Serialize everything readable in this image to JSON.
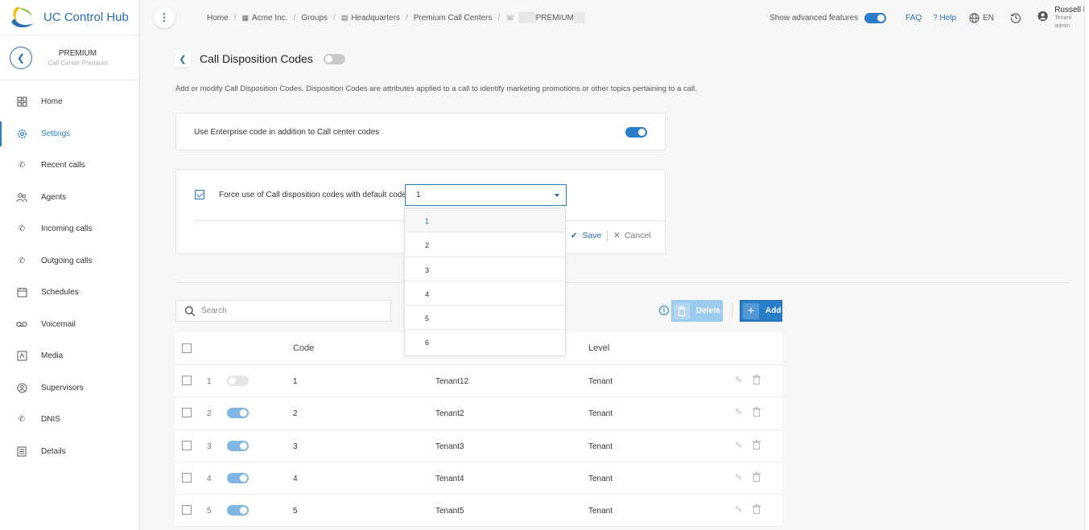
{
  "app": {
    "title": "UC Control Hub"
  },
  "context": {
    "title": "PREMIUM",
    "subtitle": "Call Center Premium"
  },
  "sidebar": {
    "items": [
      {
        "label": "Home",
        "icon": "grid-icon",
        "active": false
      },
      {
        "label": "Settings",
        "icon": "gear-icon",
        "active": true
      },
      {
        "label": "Recent calls",
        "icon": "phone-recent-icon",
        "active": false
      },
      {
        "label": "Agents",
        "icon": "agents-icon",
        "active": false
      },
      {
        "label": "Incoming calls",
        "icon": "phone-incoming-icon",
        "active": false
      },
      {
        "label": "Outgoing calls",
        "icon": "phone-outgoing-icon",
        "active": false
      },
      {
        "label": "Schedules",
        "icon": "calendar-icon",
        "active": false
      },
      {
        "label": "Voicemail",
        "icon": "voicemail-icon",
        "active": false
      },
      {
        "label": "Media",
        "icon": "media-icon",
        "active": false
      },
      {
        "label": "Supervisors",
        "icon": "supervisors-icon",
        "active": false
      },
      {
        "label": "DNIS",
        "icon": "phone-dnis-icon",
        "active": false
      },
      {
        "label": "Details",
        "icon": "details-icon",
        "active": false
      }
    ]
  },
  "breadcrumb": {
    "items": [
      "Home",
      "Acme Inc.",
      "Groups",
      "Headquarters",
      "Premium Call Centers",
      "PREMIUM"
    ]
  },
  "topbar": {
    "advanced_label": "Show advanced features",
    "advanced_on": true,
    "faq": "FAQ",
    "help": "Help",
    "language": "EN",
    "user_name": "Russell N",
    "user_role_1": "Tenant",
    "user_role_2": "admin"
  },
  "page": {
    "title": "Call Disposition Codes",
    "enabled": false,
    "description": "Add or modify Call Disposition Codes. Disposition Codes are attributes applied to a call to identify marketing promotions or other topics pertaining to a call."
  },
  "enterprise": {
    "label": "Use Enterprise code in addition to Call center codes",
    "on": true
  },
  "force": {
    "label": "Force use of Call disposition codes with default code:",
    "checked": true,
    "value": "1",
    "options": [
      "1",
      "2",
      "3",
      "4",
      "5",
      "6"
    ],
    "save": "Save",
    "cancel": "Cancel"
  },
  "toolbar": {
    "search_placeholder": "Search",
    "delete": "Delete",
    "add": "Add"
  },
  "table": {
    "headers": {
      "code": "Code",
      "level": "Level"
    },
    "rows": [
      {
        "num": "1",
        "active": false,
        "code": "1",
        "description": "Tenant12",
        "level": "Tenant"
      },
      {
        "num": "2",
        "active": true,
        "code": "2",
        "description": "Tenant2",
        "level": "Tenant"
      },
      {
        "num": "3",
        "active": true,
        "code": "3",
        "description": "Tenant3",
        "level": "Tenant"
      },
      {
        "num": "4",
        "active": true,
        "code": "4",
        "description": "Tenant4",
        "level": "Tenant"
      },
      {
        "num": "5",
        "active": true,
        "code": "5",
        "description": "Tenant5",
        "level": "Tenant"
      }
    ]
  },
  "colors": {
    "accent": "#2a7ec8",
    "brand": "#2a6db3",
    "disabled_button": "#9dcbeb"
  }
}
